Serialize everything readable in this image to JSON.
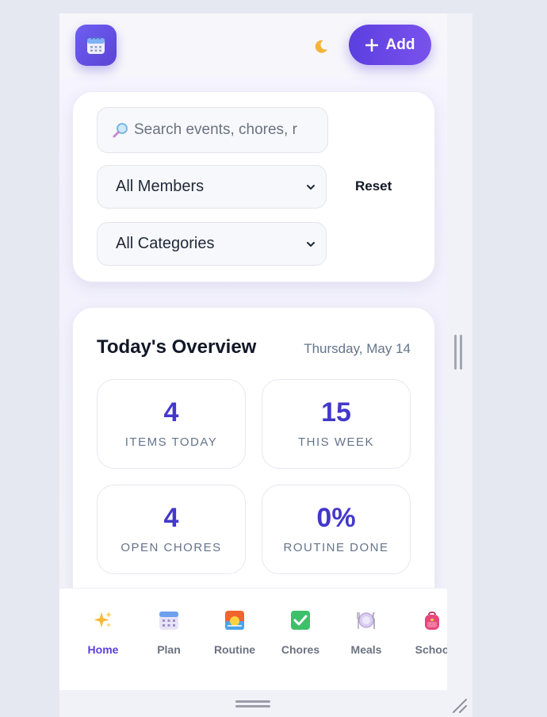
{
  "header": {
    "logo_icon": "calendar-icon",
    "theme_toggle_icon": "crescent-moon-icon",
    "add_button_label": "Add",
    "brand_colors": {
      "primary": "#5b3fe0",
      "accent": "#7a52ec"
    }
  },
  "filters": {
    "search_placeholder": "Search events, chores, r",
    "member_select": {
      "selected": "All Members"
    },
    "category_select": {
      "selected": "All Categories"
    },
    "reset_label": "Reset"
  },
  "overview": {
    "title": "Today's Overview",
    "date": "Thursday, May 14",
    "stats": [
      {
        "value": "4",
        "label": "ITEMS TODAY"
      },
      {
        "value": "15",
        "label": "THIS WEEK"
      },
      {
        "value": "4",
        "label": "OPEN CHORES"
      },
      {
        "value": "0%",
        "label": "ROUTINE DONE"
      }
    ]
  },
  "nav": {
    "items": [
      {
        "label": "Home",
        "icon": "sparkles-icon",
        "active": true
      },
      {
        "label": "Plan",
        "icon": "calendar-icon",
        "active": false
      },
      {
        "label": "Routine",
        "icon": "sunrise-icon",
        "active": false
      },
      {
        "label": "Chores",
        "icon": "check-box-icon",
        "active": false
      },
      {
        "label": "Meals",
        "icon": "plate-icon",
        "active": false
      },
      {
        "label": "Schoo",
        "icon": "backpack-icon",
        "active": false
      }
    ]
  }
}
